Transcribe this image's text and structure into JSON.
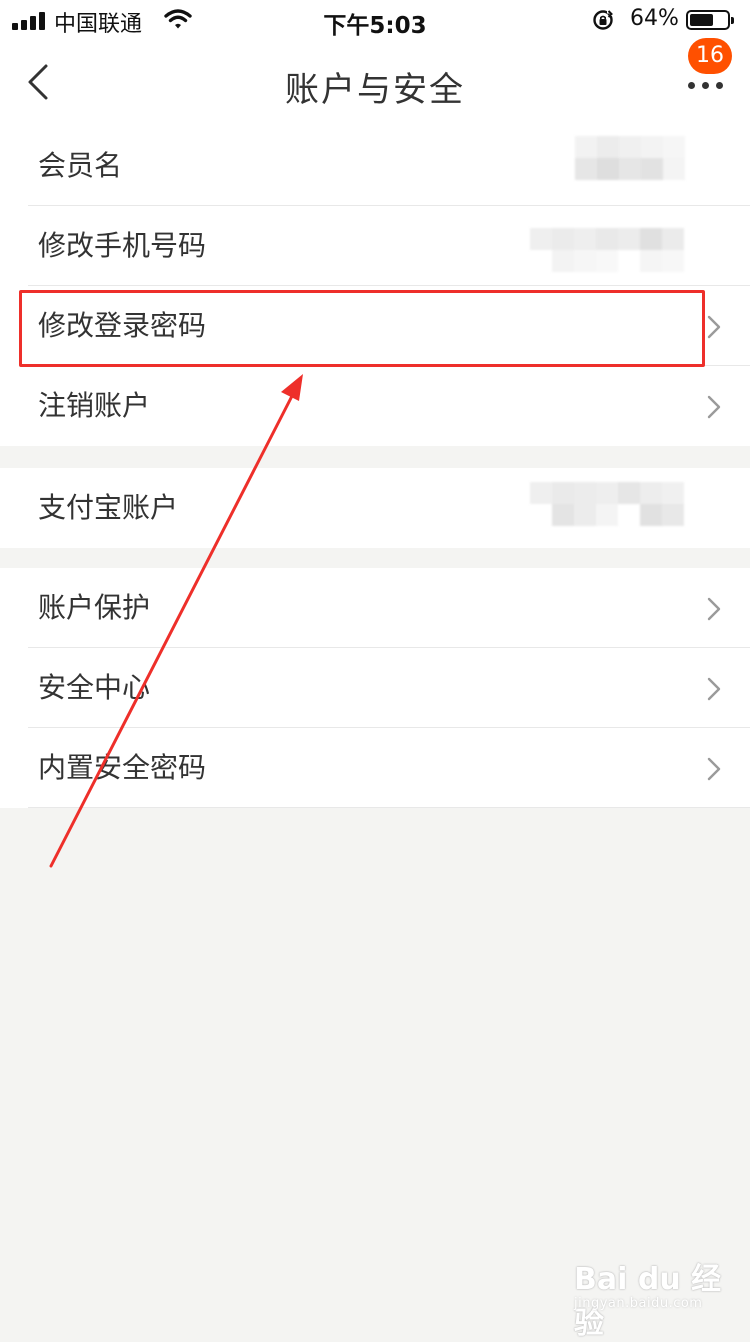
{
  "status_bar": {
    "carrier": "中国联通",
    "time": "下午5:03",
    "battery_percent": "64%",
    "battery_level": 0.64,
    "icons": [
      "signal-icon",
      "wifi-icon",
      "rotation-lock-icon",
      "battery-icon"
    ]
  },
  "nav": {
    "title": "账户与安全",
    "badge_count": "16",
    "icons": [
      "back-icon",
      "more-icon"
    ]
  },
  "groups": [
    {
      "rows": [
        {
          "label": "会员名",
          "value_hidden": true,
          "chevron": false
        },
        {
          "label": "修改手机号码",
          "value_hidden": true,
          "chevron": false
        },
        {
          "label": "修改登录密码",
          "chevron": true,
          "highlighted": true
        },
        {
          "label": "注销账户",
          "chevron": true
        }
      ]
    },
    {
      "rows": [
        {
          "label": "支付宝账户",
          "value_hidden": true,
          "chevron": false
        }
      ]
    },
    {
      "rows": [
        {
          "label": "账户保护",
          "chevron": true
        },
        {
          "label": "安全中心",
          "chevron": true
        },
        {
          "label": "内置安全密码",
          "chevron": true
        }
      ]
    }
  ],
  "annotation": {
    "color": "#ee2f2a",
    "target": "修改登录密码"
  },
  "watermark": {
    "main": "Bai du 经验",
    "sub": "jingyan.baidu.com"
  },
  "colors": {
    "background": "#f4f4f2",
    "badge": "#ff5000",
    "text": "#333333",
    "chevron": "#9a9a9a"
  }
}
